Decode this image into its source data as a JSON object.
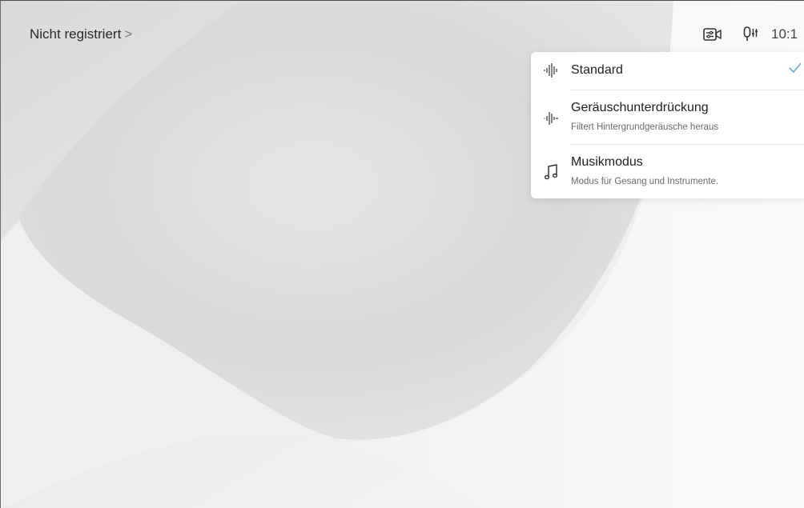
{
  "status_bar": {
    "registration_label": "Nicht registriert",
    "chevron": ">",
    "clock": "10:1",
    "camera_icon": "camera-controls-icon",
    "mic_icon": "microphone-settings-icon"
  },
  "audio_menu": {
    "items": [
      {
        "title": "Standard",
        "subtitle": "",
        "icon": "waveform-icon",
        "selected": true
      },
      {
        "title": "Geräuschunterdrückung",
        "subtitle": "Filtert Hintergrundgeräusche heraus",
        "icon": "noise-reduction-waveform-icon",
        "selected": false
      },
      {
        "title": "Musikmodus",
        "subtitle": "Modus für Gesang und Instrumente.",
        "icon": "music-note-icon",
        "selected": false
      }
    ],
    "check_color": "#5bb5d6"
  }
}
